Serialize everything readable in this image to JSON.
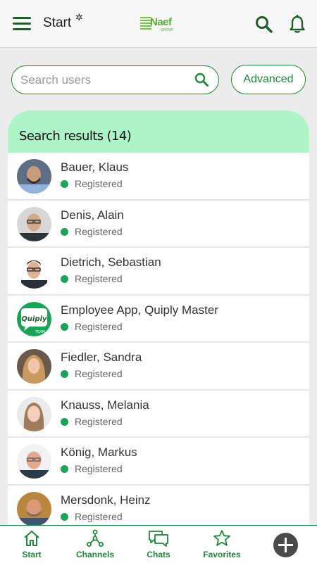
{
  "header": {
    "title": "Start",
    "gear_symbol": "✲",
    "logo_name": "Naef",
    "logo_sub": "GROUP"
  },
  "search": {
    "placeholder": "Search users",
    "value": "",
    "advanced_label": "Advanced"
  },
  "results": {
    "header": "Search results (14)",
    "users": [
      {
        "name": "Bauer, Klaus",
        "status": "Registered"
      },
      {
        "name": "Denis, Alain",
        "status": "Registered"
      },
      {
        "name": "Dietrich, Sebastian",
        "status": "Registered"
      },
      {
        "name": "Employee App, Quiply Master",
        "status": "Registered"
      },
      {
        "name": "Fiedler, Sandra",
        "status": "Registered"
      },
      {
        "name": "Knauss, Melania",
        "status": "Registered"
      },
      {
        "name": "König, Markus",
        "status": "Registered"
      },
      {
        "name": "Mersdonk, Heinz",
        "status": "Registered"
      }
    ],
    "quiply_avatar_text": "Quiply",
    "quiply_avatar_sub": "TEAM"
  },
  "nav": {
    "items": [
      {
        "label": "Start",
        "icon": "home-icon"
      },
      {
        "label": "Channels",
        "icon": "channels-icon"
      },
      {
        "label": "Chats",
        "icon": "chats-icon"
      },
      {
        "label": "Favorites",
        "icon": "star-icon"
      }
    ]
  },
  "colors": {
    "accent": "#1d8a3a",
    "header_bg": "#adf5c6",
    "status_online": "#1aa556"
  }
}
